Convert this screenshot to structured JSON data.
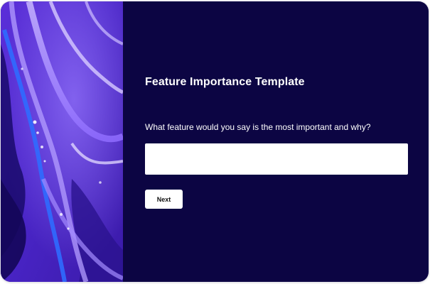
{
  "survey": {
    "title": "Feature Importance Template",
    "question": "What feature would you say is the most important and why?",
    "answer_value": "",
    "next_label": "Next"
  },
  "colors": {
    "panel_background": "#0c0543",
    "button_background": "#ffffff",
    "input_background": "#ffffff",
    "title_text": "#ffffff"
  },
  "side_image": {
    "description_icon": "abstract-fluid-art-image"
  }
}
